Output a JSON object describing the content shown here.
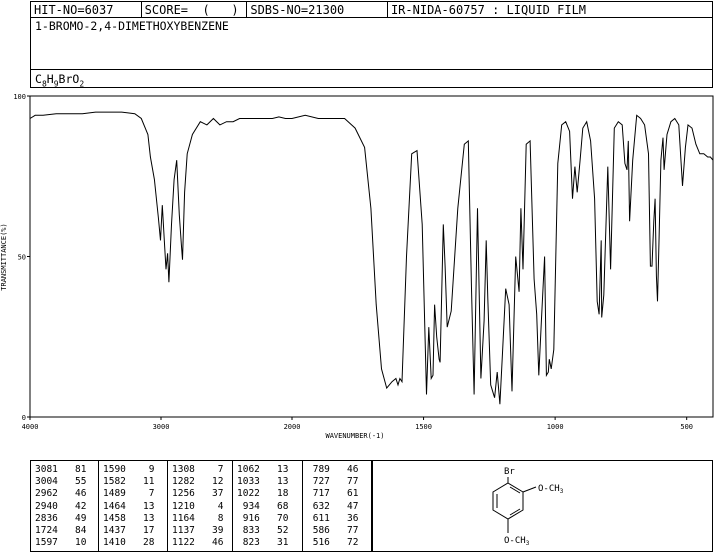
{
  "header": {
    "hit_no": "HIT-NO=6037",
    "score": "SCORE=  (   )",
    "sdbs_no": "SDBS-NO=21300",
    "ir_nida": "IR-NIDA-60757 : LIQUID FILM",
    "compound_name": "1-BROMO-2,4-DIMETHOXYBENZENE",
    "formula": {
      "c": "C",
      "c_n": "8",
      "h": "H",
      "h_n": "9",
      "rest": "BrO",
      "o_n": "2"
    }
  },
  "chart_data": {
    "type": "line",
    "xlabel": "WAVENUMBER(-1)",
    "ylabel": "TRANSMITTANCE(%)",
    "xlim": [
      4000,
      400
    ],
    "ylim": [
      0,
      100
    ],
    "x_ticks": [
      4000,
      3000,
      2000,
      1500,
      1000,
      500
    ],
    "y_ticks": [
      100,
      50,
      0
    ],
    "grid": false,
    "series": [
      {
        "x": [
          4000,
          3960,
          3900,
          3800,
          3700,
          3600,
          3500,
          3400,
          3300,
          3200,
          3150,
          3100,
          3081,
          3050,
          3020,
          3004,
          2990,
          2975,
          2962,
          2950,
          2940,
          2920,
          2900,
          2880,
          2860,
          2845,
          2836,
          2820,
          2800,
          2760,
          2700,
          2650,
          2600,
          2550,
          2500,
          2450,
          2400,
          2350,
          2300,
          2250,
          2200,
          2150,
          2100,
          2050,
          2000,
          1950,
          1900,
          1850,
          1800,
          1760,
          1724,
          1700,
          1680,
          1660,
          1640,
          1620,
          1605,
          1597,
          1590,
          1582,
          1565,
          1545,
          1525,
          1505,
          1489,
          1480,
          1471,
          1464,
          1458,
          1450,
          1441,
          1437,
          1425,
          1418,
          1410,
          1395,
          1370,
          1345,
          1330,
          1318,
          1308,
          1295,
          1282,
          1270,
          1262,
          1256,
          1245,
          1230,
          1220,
          1210,
          1200,
          1188,
          1175,
          1164,
          1150,
          1137,
          1130,
          1122,
          1110,
          1095,
          1080,
          1070,
          1062,
          1052,
          1040,
          1033,
          1026,
          1022,
          1015,
          1005,
          990,
          975,
          960,
          945,
          934,
          925,
          916,
          905,
          895,
          880,
          865,
          850,
          840,
          833,
          825,
          823,
          815,
          800,
          789,
          775,
          760,
          745,
          735,
          727,
          722,
          717,
          705,
          690,
          675,
          660,
          645,
          638,
          632,
          625,
          620,
          615,
          611,
          605,
          598,
          590,
          586,
          575,
          560,
          545,
          530,
          516,
          505,
          495,
          480,
          465,
          450,
          435,
          420,
          410,
          400
        ],
        "y": [
          93,
          94,
          94,
          94.5,
          94.5,
          94.5,
          95,
          95,
          95,
          94.5,
          93,
          88,
          81,
          74,
          62,
          55,
          66,
          55,
          46,
          51,
          42,
          60,
          74,
          80,
          63,
          54,
          49,
          70,
          82,
          88,
          92,
          91,
          93,
          91,
          92,
          92,
          93,
          93,
          93,
          93,
          93,
          93,
          93.5,
          93,
          93,
          94,
          93,
          93,
          93,
          90,
          84,
          65,
          35,
          15,
          9,
          11,
          12,
          10,
          12,
          11,
          50,
          82,
          83,
          60,
          7,
          28,
          12,
          13,
          35,
          25,
          18,
          17,
          60,
          47,
          28,
          33,
          65,
          85,
          86,
          40,
          7,
          65,
          12,
          30,
          55,
          37,
          10,
          6,
          14,
          4,
          20,
          40,
          35,
          8,
          50,
          39,
          65,
          46,
          85,
          86,
          43,
          32,
          13,
          30,
          50,
          13,
          14,
          18,
          15,
          21,
          79,
          91,
          92,
          89,
          68,
          78,
          70,
          80,
          90,
          92,
          86,
          68,
          36,
          32,
          55,
          31,
          38,
          78,
          46,
          90,
          92,
          91,
          79,
          77,
          86,
          61,
          80,
          94,
          93,
          91,
          82,
          47,
          47,
          61,
          68,
          44,
          36,
          56,
          80,
          87,
          77,
          88,
          92,
          93,
          91,
          72,
          84,
          91,
          90,
          85,
          82,
          82,
          81,
          81,
          80
        ]
      }
    ],
    "peaks": [
      [
        "3081",
        "81"
      ],
      [
        "3004",
        "55"
      ],
      [
        "2962",
        "46"
      ],
      [
        "2940",
        "42"
      ],
      [
        "2836",
        "49"
      ],
      [
        "1724",
        "84"
      ],
      [
        "1597",
        "10"
      ],
      [
        "1590",
        "9"
      ],
      [
        "1582",
        "11"
      ],
      [
        "1489",
        "7"
      ],
      [
        "1464",
        "13"
      ],
      [
        "1458",
        "13"
      ],
      [
        "1437",
        "17"
      ],
      [
        "1410",
        "28"
      ],
      [
        "1308",
        "7"
      ],
      [
        "1282",
        "12"
      ],
      [
        "1256",
        "37"
      ],
      [
        "1210",
        "4"
      ],
      [
        "1164",
        "8"
      ],
      [
        "1137",
        "39"
      ],
      [
        "1122",
        "46"
      ],
      [
        "1062",
        "13"
      ],
      [
        "1033",
        "13"
      ],
      [
        "1022",
        "18"
      ],
      [
        "934",
        "68"
      ],
      [
        "916",
        "70"
      ],
      [
        "833",
        "52"
      ],
      [
        "823",
        "31"
      ],
      [
        "789",
        "46"
      ],
      [
        "727",
        "77"
      ],
      [
        "717",
        "61"
      ],
      [
        "632",
        "47"
      ],
      [
        "611",
        "36"
      ],
      [
        "586",
        "77"
      ],
      [
        "516",
        "72"
      ]
    ]
  },
  "structure": {
    "br": "Br",
    "sub1": "O-CH",
    "sub1_n": "3",
    "sub2": "O-CH",
    "sub2_n": "3"
  }
}
